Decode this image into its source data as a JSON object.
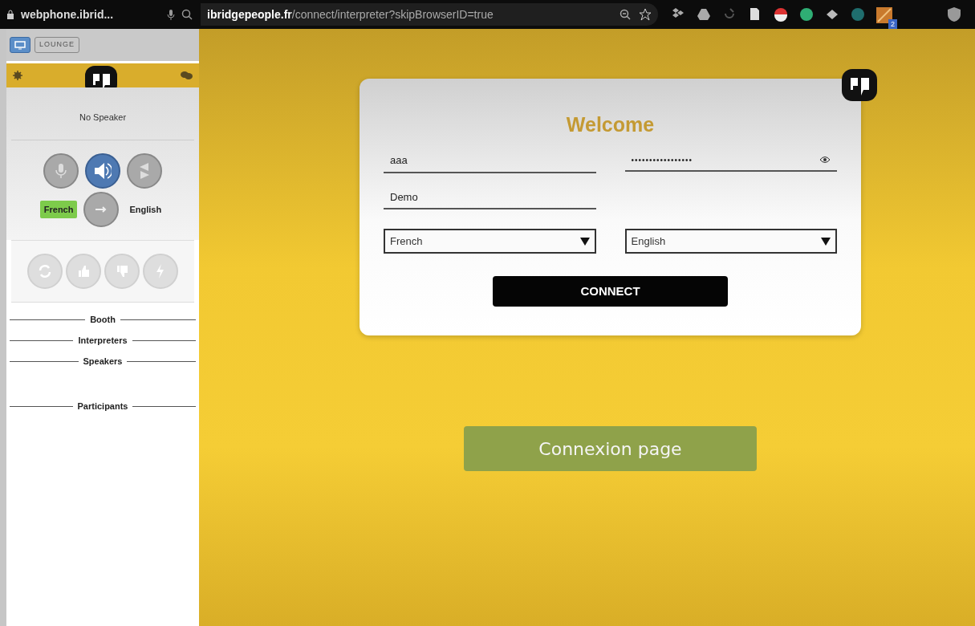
{
  "browser": {
    "tab_title": "webphone.ibrid...",
    "url_host": "ibridgepeople.fr",
    "url_path": "/connect/interpreter?skipBrowserID=true",
    "extension_badge": "2"
  },
  "sidebar": {
    "view_buttons": [
      {
        "kind": "screen",
        "selected": true
      },
      {
        "kind": "text",
        "label": "LOUNGE",
        "selected": false
      }
    ],
    "speaker_status": "No Speaker",
    "audio_buttons": [
      {
        "kind": "mic",
        "selected": false
      },
      {
        "kind": "speaker",
        "selected": true
      },
      {
        "kind": "switch",
        "selected": false
      }
    ],
    "languages": [
      {
        "label": "French",
        "selected": true
      },
      {
        "label": "English",
        "selected": false
      }
    ],
    "actions": [
      {
        "kind": "refresh",
        "disabled": true
      },
      {
        "kind": "like",
        "disabled": true
      },
      {
        "kind": "dislike",
        "disabled": true
      },
      {
        "kind": "flash",
        "disabled": true
      }
    ],
    "sections": [
      {
        "label": "Booth"
      },
      {
        "label": "Interpreters"
      },
      {
        "label": "Speakers"
      },
      {
        "label": "Participants"
      }
    ]
  },
  "login": {
    "title": "Welcome",
    "username": {
      "value": "aaa"
    },
    "password": {
      "value": "•••••••••••••••••"
    },
    "room": {
      "value": "Demo"
    },
    "source_language": "French",
    "target_language": "English",
    "connect_button": "CONNECT"
  },
  "page_button": "Connexion page"
}
